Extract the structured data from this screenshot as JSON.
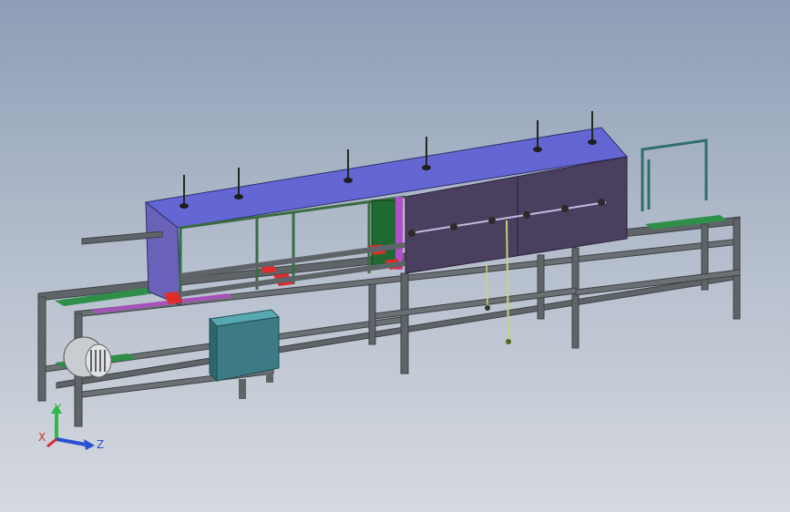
{
  "viewport": {
    "background_top": "#8e9db6",
    "background_bottom": "#d6d9df"
  },
  "model": {
    "description_icon": "conveyor-oven-assembly",
    "colors": {
      "frame": "#5f6468",
      "frame_dark": "#3e4245",
      "hood_top": "#6466d4",
      "hood_side": "#4a3f5f",
      "hood_front": "#6a62b8",
      "rail_green": "#2f8f4a",
      "belt_purple": "#b04fc7",
      "marker_red": "#e02b2b",
      "control_box": "#3c7a84",
      "control_box_top": "#58a8b2",
      "motor": "#c9ccd0",
      "pole": "#c8d27a",
      "window_frame": "#2f6f6a"
    }
  },
  "triad": {
    "x_label": "X",
    "y_label": "Y",
    "z_label": "Z",
    "x_color": "#d22a2a",
    "y_color": "#2fb84a",
    "z_color": "#2a4fd2"
  }
}
